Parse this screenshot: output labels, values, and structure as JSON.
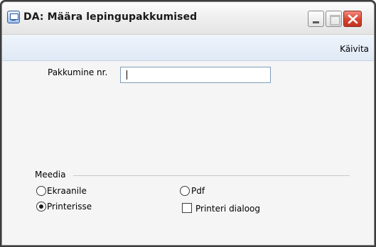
{
  "window": {
    "title": "DA: Määra lepingupakkumised",
    "controls": [
      "minimize-icon",
      "maximize-icon",
      "close-icon"
    ]
  },
  "menubar": {
    "run_label": "Käivita"
  },
  "form": {
    "field_label": "Pakkumine nr.",
    "field_value": ""
  },
  "media": {
    "group_label": "Meedia",
    "options": {
      "screen": {
        "label": "Ekraanile",
        "selected": false
      },
      "printer": {
        "label": "Printerisse",
        "selected": true
      },
      "pdf": {
        "label": "Pdf",
        "selected": false
      }
    },
    "printer_dialog": {
      "label": "Printeri dialoog",
      "checked": false
    }
  },
  "colors": {
    "close_button": "#d7442f",
    "menubar": "#e6eef8"
  }
}
